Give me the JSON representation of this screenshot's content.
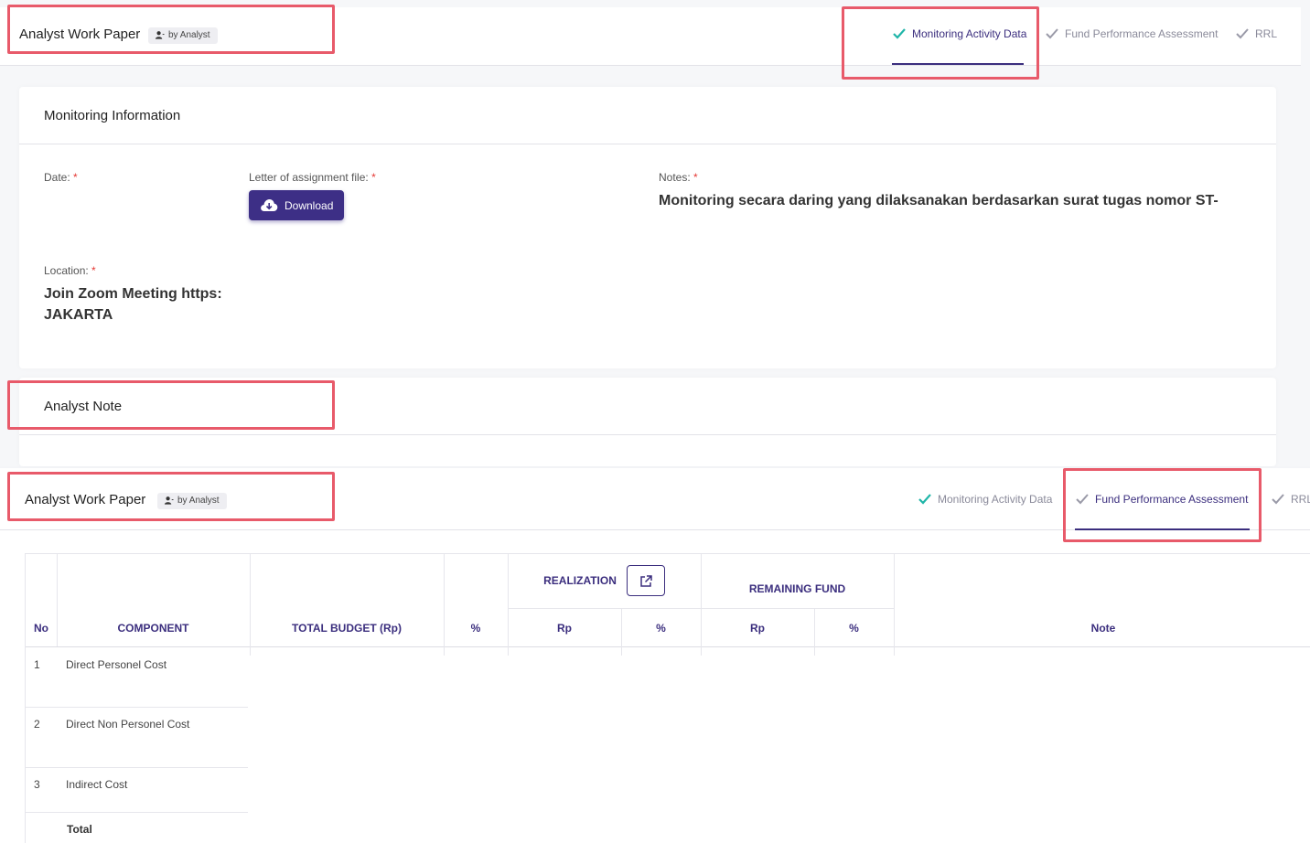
{
  "top": {
    "title": "Analyst Work Paper",
    "badge": "by Analyst",
    "tabs": [
      {
        "label": "Monitoring Activity Data",
        "done": true,
        "active": true
      },
      {
        "label": "Fund Performance Assessment",
        "done": true,
        "active": false
      },
      {
        "label": "RRL",
        "done": true,
        "active": false
      }
    ]
  },
  "monitoring": {
    "section_title": "Monitoring Information",
    "date_label": "Date:",
    "letter_label": "Letter of assignment file:",
    "download_label": "Download",
    "notes_label": "Notes:",
    "notes_value": "Monitoring secara daring yang dilaksanakan berdasarkan surat tugas nomor ST-",
    "location_label": "Location:",
    "location_line1": "Join Zoom Meeting https:",
    "location_line2": "JAKARTA",
    "required_mark": "*"
  },
  "analyst_note": {
    "section_title": "Analyst Note"
  },
  "bottom": {
    "title": "Analyst Work Paper",
    "badge": "by Analyst",
    "tabs": [
      {
        "label": "Monitoring Activity Data",
        "done": true,
        "active": false
      },
      {
        "label": "Fund Performance Assessment",
        "done": true,
        "active": true
      },
      {
        "label": "RRL",
        "done": true,
        "active": false
      }
    ]
  },
  "table": {
    "headers": {
      "no": "No",
      "component": "COMPONENT",
      "total_budget": "TOTAL BUDGET (Rp)",
      "pct": "%",
      "realization": "REALIZATION",
      "remaining": "REMAINING FUND",
      "rp": "Rp",
      "sub_pct": "%",
      "note": "Note"
    },
    "rows": [
      {
        "no": "1",
        "component": "Direct Personel Cost"
      },
      {
        "no": "2",
        "component": "Direct Non Personel Cost"
      },
      {
        "no": "3",
        "component": "Indirect Cost"
      },
      {
        "no": "",
        "component": "Total"
      }
    ]
  },
  "colors": {
    "accent": "#3b2e7e",
    "check_active": "#1fb5a8",
    "highlight": "#e85a6a",
    "required": "#e53935"
  }
}
